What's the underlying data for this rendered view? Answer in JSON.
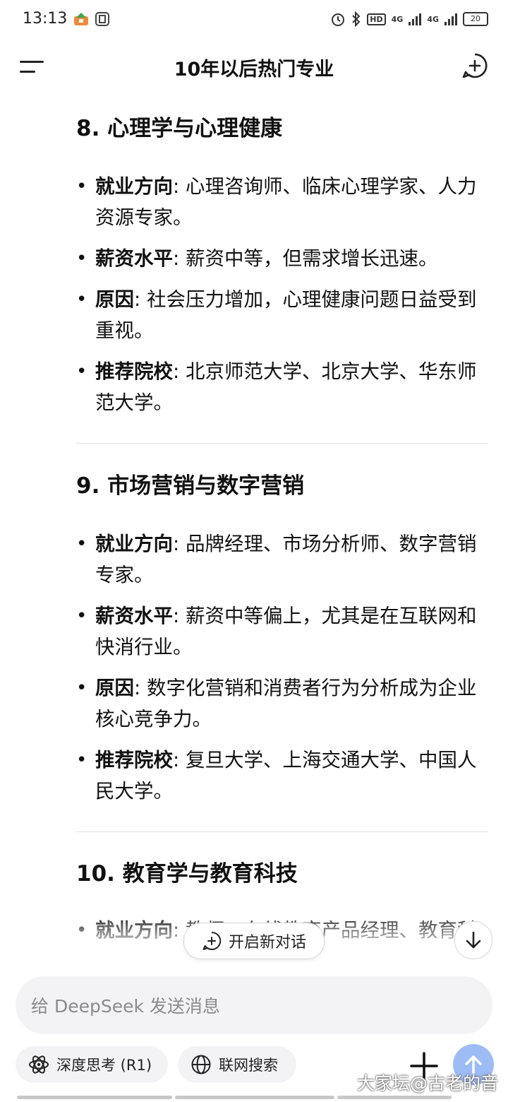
{
  "status_bar": {
    "time": "13:13",
    "hd_label": "HD",
    "net1": "4G",
    "net2": "4G",
    "battery": "20"
  },
  "header": {
    "title": "10年以后热门专业"
  },
  "sections": [
    {
      "title": "8. 心理学与心理健康",
      "items": [
        {
          "label": "就业方向",
          "text": ": 心理咨询师、临床心理学家、人力资源专家。"
        },
        {
          "label": "薪资水平",
          "text": ": 薪资中等，但需求增长迅速。"
        },
        {
          "label": "原因",
          "text": ": 社会压力增加，心理健康问题日益受到重视。"
        },
        {
          "label": "推荐院校",
          "text": ": 北京师范大学、北京大学、华东师范大学。"
        }
      ]
    },
    {
      "title": "9. 市场营销与数字营销",
      "items": [
        {
          "label": "就业方向",
          "text": ": 品牌经理、市场分析师、数字营销专家。"
        },
        {
          "label": "薪资水平",
          "text": ": 薪资中等偏上，尤其是在互联网和快消行业。"
        },
        {
          "label": "原因",
          "text": ": 数字化营销和消费者行为分析成为企业核心竞争力。"
        },
        {
          "label": "推荐院校",
          "text": ": 复旦大学、上海交通大学、中国人民大学。"
        }
      ]
    },
    {
      "title": "10. 教育学与教育科技",
      "items": [
        {
          "label": "就业方向",
          "text": ": 教师、在线教育产品经理、教育科"
        }
      ]
    }
  ],
  "floating": {
    "new_chat_label": "开启新对话"
  },
  "input": {
    "placeholder": "给 DeepSeek 发送消息"
  },
  "toolbar": {
    "deep_think_label": "深度思考 (R1)",
    "web_search_label": "联网搜索"
  },
  "watermark": "大家坛@古老的音",
  "colors": {
    "send_button": "#9dbcf6",
    "input_bg": "#f3f3f5",
    "divider": "#e3e3e3"
  },
  "icons": [
    "menu-icon",
    "new-chat-icon",
    "atom-icon",
    "globe-icon",
    "plus-icon",
    "arrow-up-icon",
    "arrow-down-icon",
    "chat-plus-icon"
  ]
}
